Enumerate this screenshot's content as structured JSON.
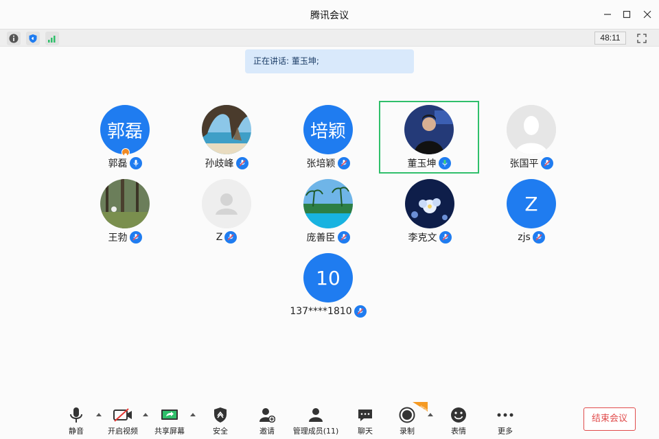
{
  "window": {
    "title": "腾讯会议"
  },
  "toolbar": {
    "timer": "48:11"
  },
  "speaking": {
    "text": "正在讲话: 董玉坤;"
  },
  "participants": [
    {
      "name": "郭磊",
      "avatar_text": "郭磊",
      "avatar_type": "text",
      "mic": "mic-icon",
      "host": true
    },
    {
      "name": "孙歧峰",
      "avatar_type": "photo-beach",
      "mic": "mic-muted-icon"
    },
    {
      "name": "张培颖",
      "avatar_text": "培颖",
      "avatar_type": "text",
      "mic": "mic-muted-icon"
    },
    {
      "name": "董玉坤",
      "avatar_type": "photo-person",
      "mic": "mic-active-icon",
      "active": true
    },
    {
      "name": "张国平",
      "avatar_type": "default",
      "mic": "mic-muted-icon"
    },
    {
      "name": "王勃",
      "avatar_type": "photo-forest",
      "mic": "mic-muted-icon"
    },
    {
      "name": "Z",
      "avatar_type": "default-light",
      "mic": "mic-muted-icon"
    },
    {
      "name": "庞善臣",
      "avatar_type": "photo-pool",
      "mic": "mic-muted-icon"
    },
    {
      "name": "李克文",
      "avatar_type": "photo-flower",
      "mic": "mic-muted-icon"
    },
    {
      "name": "zjs",
      "avatar_text": "Z",
      "avatar_type": "text",
      "mic": "mic-muted-icon"
    },
    {
      "name": "137****1810",
      "avatar_text": "10",
      "avatar_type": "text",
      "mic": "mic-muted-icon"
    }
  ],
  "controls": {
    "mute": "静音",
    "video": "开启视频",
    "share": "共享屏幕",
    "security": "安全",
    "invite": "邀请",
    "members": "管理成员(11)",
    "chat": "聊天",
    "record": "录制",
    "record_badge": "NEW",
    "emoji": "表情",
    "more": "更多",
    "end": "结束会议"
  },
  "colors": {
    "accent": "#1f7cf0",
    "active": "#2fbf6a",
    "danger": "#e04a4a"
  }
}
